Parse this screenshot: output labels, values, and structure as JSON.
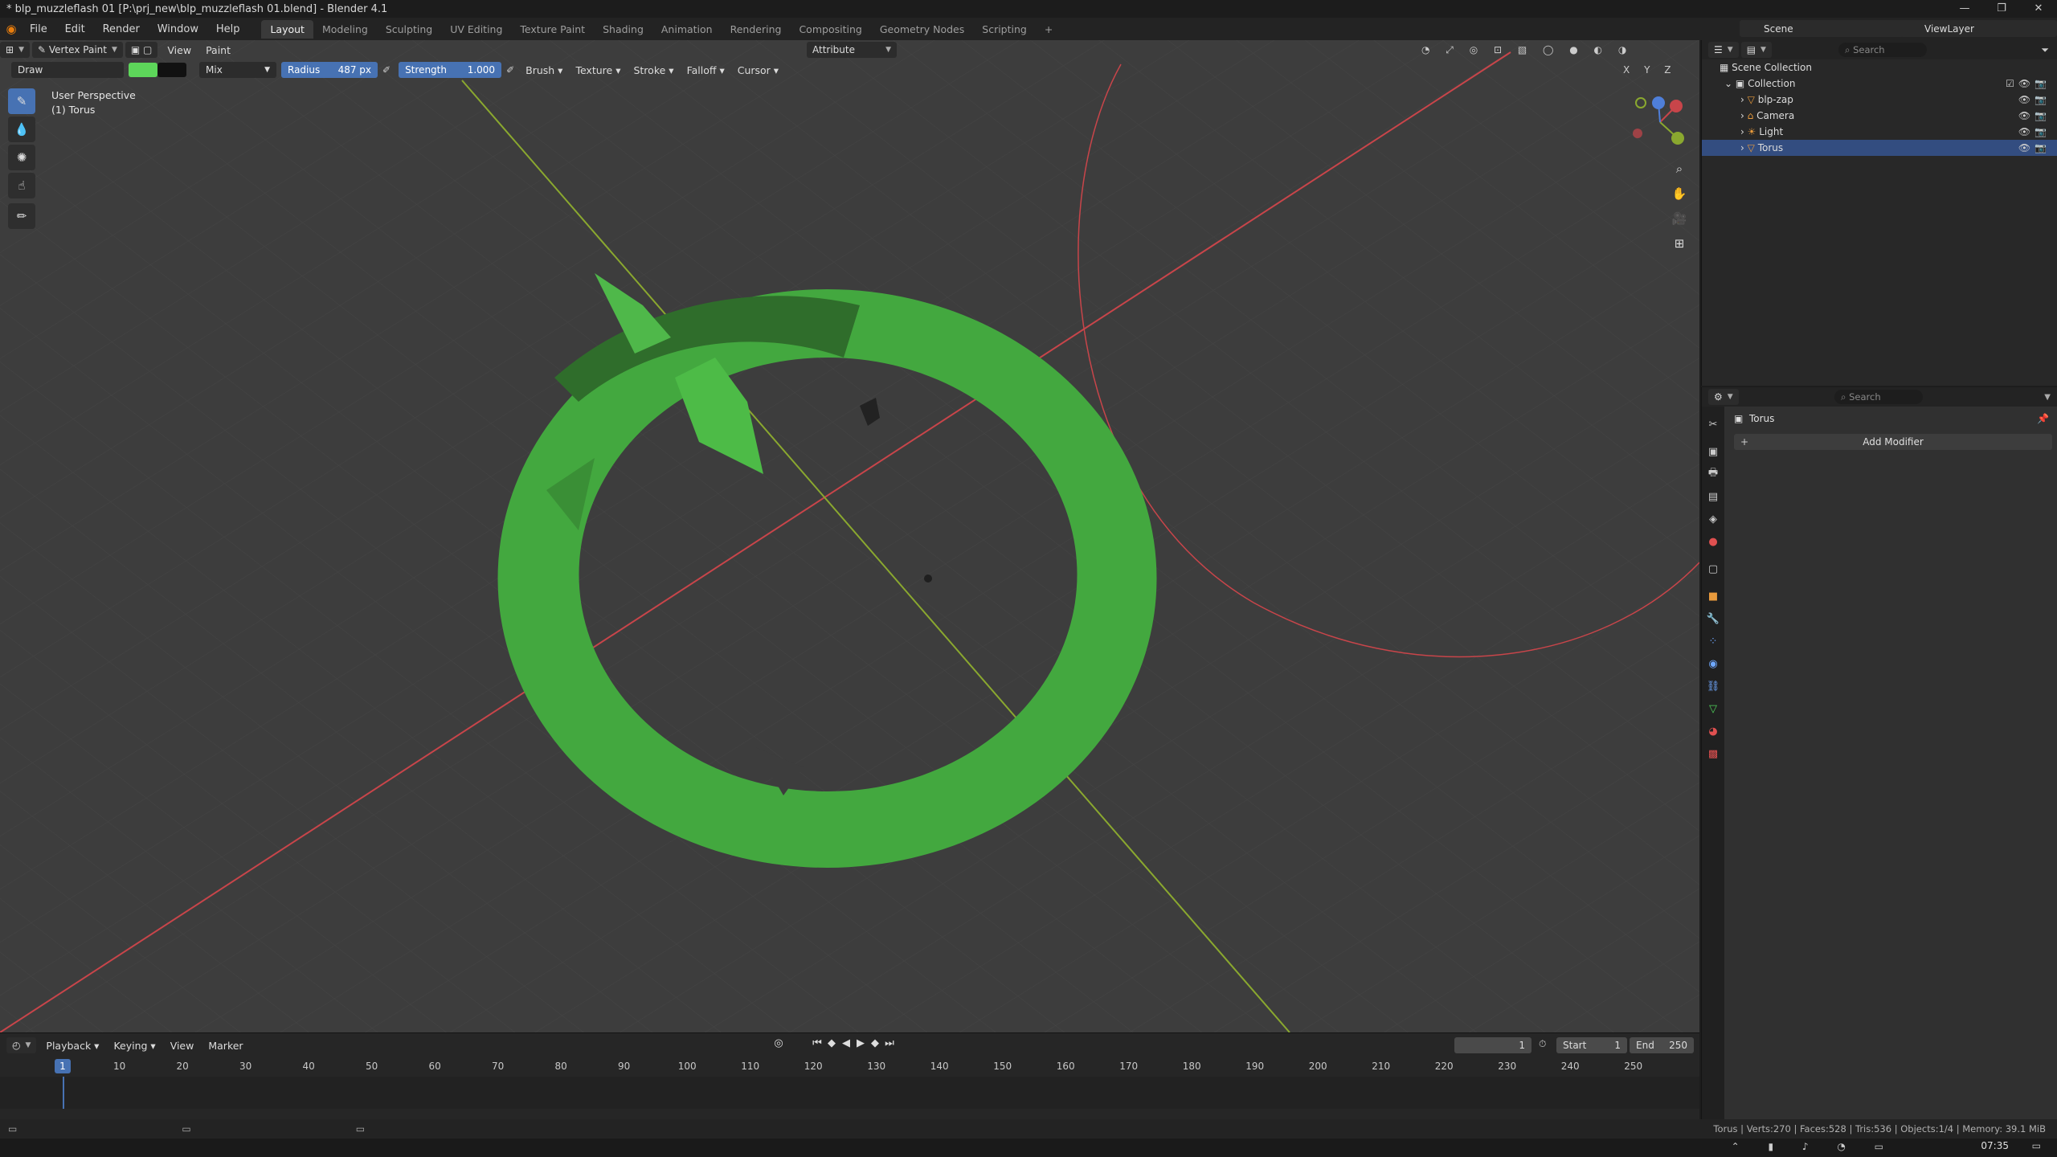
{
  "window": {
    "title": "* blp_muzzleflash 01 [P:\\prj_new\\blp_muzzleflash 01.blend] - Blender 4.1",
    "controls": [
      "—",
      "❐",
      "✕"
    ]
  },
  "menu": [
    "File",
    "Edit",
    "Render",
    "Window",
    "Help"
  ],
  "workspaces": [
    "Layout",
    "Modeling",
    "Sculpting",
    "UV Editing",
    "Texture Paint",
    "Shading",
    "Animation",
    "Rendering",
    "Compositing",
    "Geometry Nodes",
    "Scripting"
  ],
  "active_workspace": "Layout",
  "scene": {
    "name": "Scene",
    "view_layer": "ViewLayer"
  },
  "viewport_header": {
    "mode": "Vertex Paint",
    "menus": [
      "View",
      "Paint"
    ],
    "attribute": "Attribute",
    "axes": [
      "X",
      "Y",
      "Z"
    ]
  },
  "tool_settings": {
    "brush_name": "Draw",
    "primary_color": "#5dd65a",
    "secondary_color": "#111111",
    "blend": "Mix",
    "radius_label": "Radius",
    "radius_value": "487 px",
    "strength_label": "Strength",
    "strength_value": "1.000",
    "menus": [
      "Brush",
      "Texture",
      "Stroke",
      "Falloff",
      "Cursor"
    ]
  },
  "viewport_overlay": {
    "perspective": "User Perspective",
    "object": "(1) Torus"
  },
  "toolbar_icons": [
    "draw-brush-icon",
    "blur-brush-icon",
    "average-brush-icon",
    "smear-brush-icon",
    "annotate-icon"
  ],
  "timeline": {
    "menus": [
      "Playback",
      "Keying",
      "View",
      "Marker"
    ],
    "current_frame": "1",
    "start_label": "Start",
    "start": "1",
    "end_label": "End",
    "end": "250",
    "ticks": [
      "10",
      "20",
      "30",
      "40",
      "50",
      "60",
      "70",
      "80",
      "90",
      "100",
      "110",
      "120",
      "130",
      "140",
      "150",
      "160",
      "170",
      "180",
      "190",
      "200",
      "210",
      "220",
      "230",
      "240",
      "250"
    ]
  },
  "outliner": {
    "search_placeholder": "Search",
    "root": "Scene Collection",
    "collection": "Collection",
    "items": [
      {
        "name": "blp-zap",
        "icon": "mesh-icon"
      },
      {
        "name": "Camera",
        "icon": "camera-icon"
      },
      {
        "name": "Light",
        "icon": "light-icon"
      },
      {
        "name": "Torus",
        "icon": "mesh-icon",
        "selected": true
      }
    ]
  },
  "properties": {
    "search_placeholder": "Search",
    "object": "Torus",
    "add_modifier": "Add Modifier"
  },
  "status": {
    "stats": "Torus | Verts:270 | Faces:528 | Tris:536 | Objects:1/4 | Memory: 39.1 MiB"
  },
  "taskbar": {
    "time": "07:35"
  },
  "colors": {
    "accent": "#4772b3",
    "torus_green": "#43a83f",
    "x_axis": "#c8454a",
    "y_axis": "#8aa82f",
    "viewport_bg": "#3d3d3d"
  }
}
